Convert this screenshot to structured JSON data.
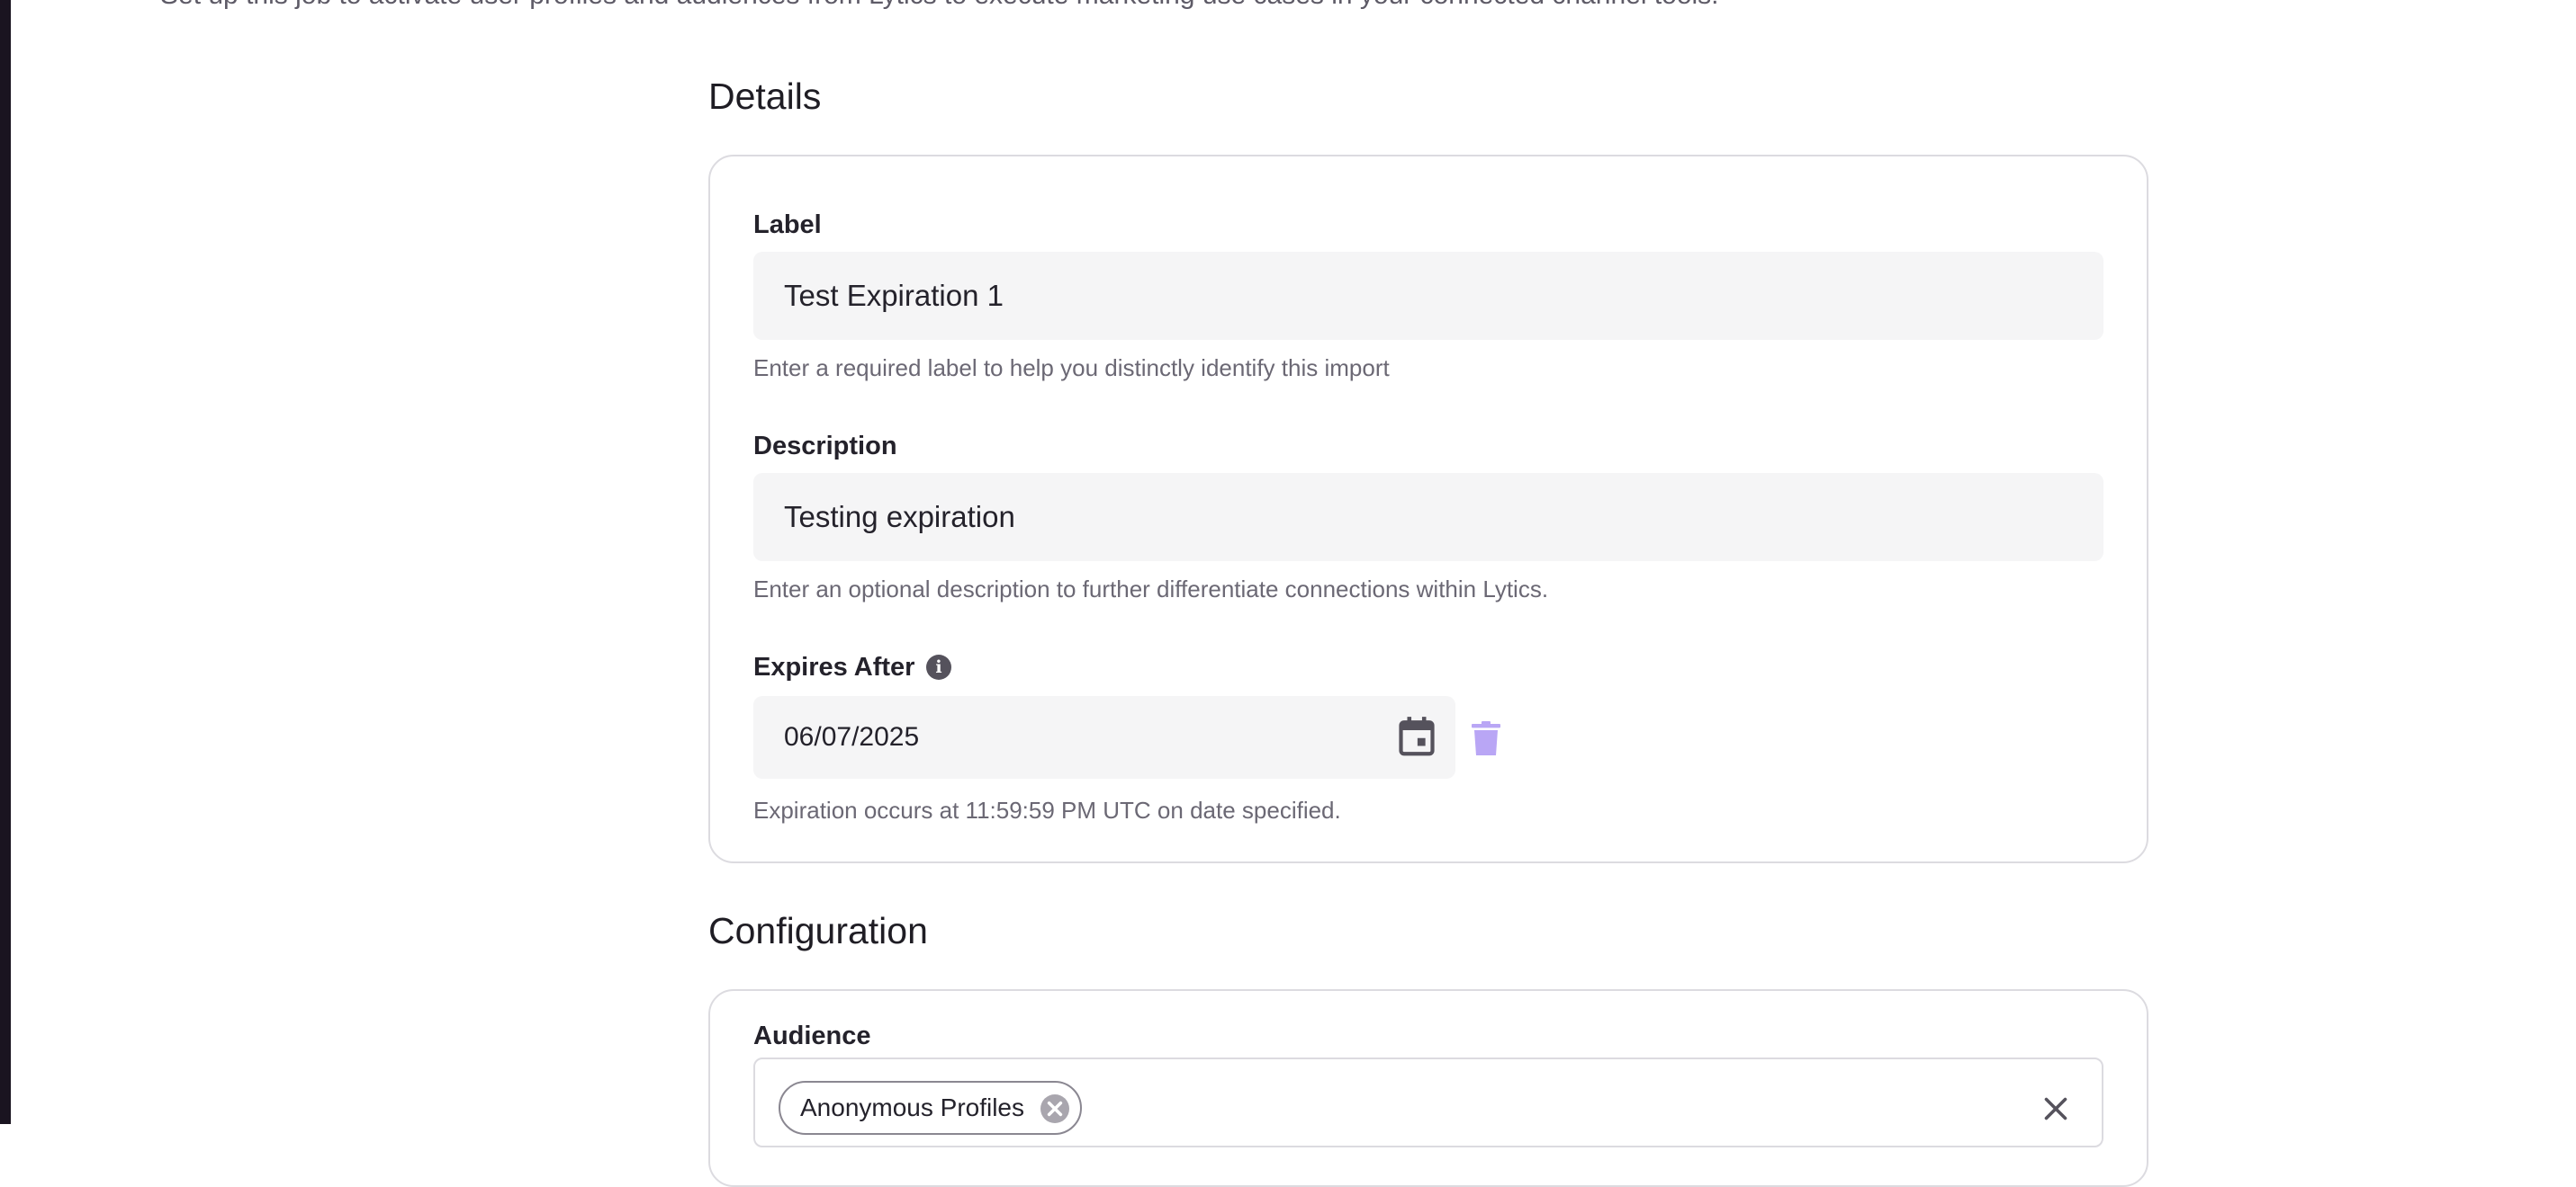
{
  "intro_text": "Set up this job to activate user profiles and audiences from Lytics to execute marketing use cases in your connected channel tools.",
  "details": {
    "title": "Details",
    "label": {
      "label": "Label",
      "value": "Test Expiration 1",
      "help": "Enter a required label to help you distinctly identify this import"
    },
    "description": {
      "label": "Description",
      "value": "Testing expiration",
      "help": "Enter an optional description to further differentiate connections within Lytics."
    },
    "expires_after": {
      "label": "Expires After",
      "info_icon": "info-icon",
      "value": "06/07/2025",
      "calendar_icon": "calendar-icon",
      "delete_icon": "trash-icon",
      "help": "Expiration occurs at 11:59:59 PM UTC on date specified."
    }
  },
  "configuration": {
    "title": "Configuration",
    "audience": {
      "label": "Audience",
      "selected": [
        "Anonymous Profiles"
      ],
      "remove_icon": "x-circle-icon",
      "clear_icon": "close-icon"
    }
  },
  "colors": {
    "sidebar": "#1a1420",
    "input_bg": "#f5f5f6",
    "card_border": "#dcdbe0",
    "trash_accent": "#b9a6f5",
    "icon_gray": "#55525c"
  }
}
